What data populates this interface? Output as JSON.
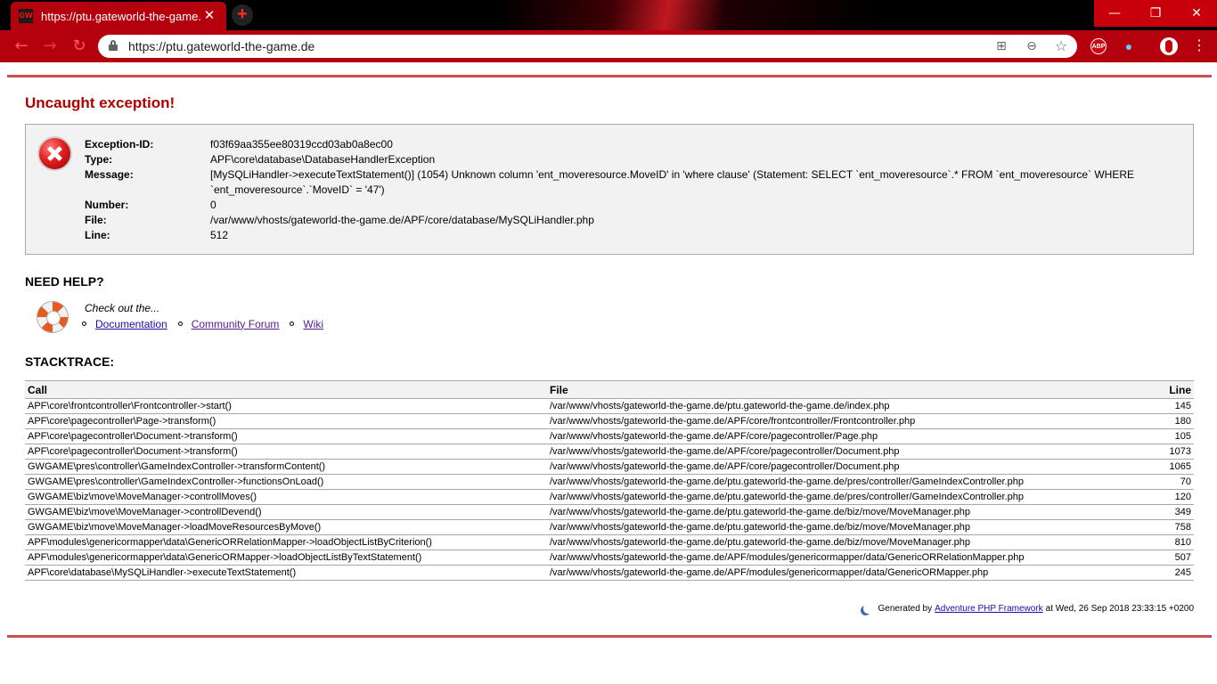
{
  "browser": {
    "tab_title": "https://ptu.gateworld-the-game.de",
    "favicon_text": "GW",
    "tab_close_glyph": "✕",
    "new_tab_glyph": "+",
    "url": "https://ptu.gateworld-the-game.de",
    "window_minimize_glyph": "—",
    "window_maximize_glyph": "❐",
    "window_close_glyph": "✕",
    "back_glyph": "←",
    "forward_glyph": "→",
    "reload_glyph": "↻",
    "translate_glyph": "⊞",
    "zoom_glyph": "⊖",
    "star_glyph": "☆",
    "abp_label": "ABP",
    "ghost_glyph": "●",
    "menu_glyph": "⋮",
    "accent_color": "#b5000e"
  },
  "error": {
    "title": "Uncaught exception!",
    "fields": [
      {
        "label": "Exception-ID:",
        "value": "f03f69aa355ee80319ccd03ab0a8ec00"
      },
      {
        "label": "Type:",
        "value": "APF\\core\\database\\DatabaseHandlerException"
      },
      {
        "label": "Message:",
        "value": "[MySQLiHandler->executeTextStatement()] (1054) Unknown column 'ent_moveresource.MoveID' in 'where clause' (Statement: SELECT `ent_moveresource`.* FROM `ent_moveresource` WHERE `ent_moveresource`.`MoveID` = '47')"
      },
      {
        "label": "Number:",
        "value": "0"
      },
      {
        "label": "File:",
        "value": "/var/www/vhosts/gateworld-the-game.de/APF/core/database/MySQLiHandler.php"
      },
      {
        "label": "Line:",
        "value": "512"
      }
    ]
  },
  "help": {
    "title": "NEED HELP?",
    "checkout": "Check out the...",
    "links": [
      "Documentation",
      "Community Forum",
      "Wiki"
    ]
  },
  "stacktrace": {
    "title": "STACKTRACE:",
    "headers": {
      "call": "Call",
      "file": "File",
      "line": "Line"
    },
    "rows": [
      {
        "call": "APF\\core\\frontcontroller\\Frontcontroller->start()",
        "file": "/var/www/vhosts/gateworld-the-game.de/ptu.gateworld-the-game.de/index.php",
        "line": "145"
      },
      {
        "call": "APF\\core\\pagecontroller\\Page->transform()",
        "file": "/var/www/vhosts/gateworld-the-game.de/APF/core/frontcontroller/Frontcontroller.php",
        "line": "180"
      },
      {
        "call": "APF\\core\\pagecontroller\\Document->transform()",
        "file": "/var/www/vhosts/gateworld-the-game.de/APF/core/pagecontroller/Page.php",
        "line": "105"
      },
      {
        "call": "APF\\core\\pagecontroller\\Document->transform()",
        "file": "/var/www/vhosts/gateworld-the-game.de/APF/core/pagecontroller/Document.php",
        "line": "1073"
      },
      {
        "call": "GWGAME\\pres\\controller\\GameIndexController->transformContent()",
        "file": "/var/www/vhosts/gateworld-the-game.de/APF/core/pagecontroller/Document.php",
        "line": "1065"
      },
      {
        "call": "GWGAME\\pres\\controller\\GameIndexController->functionsOnLoad()",
        "file": "/var/www/vhosts/gateworld-the-game.de/ptu.gateworld-the-game.de/pres/controller/GameIndexController.php",
        "line": "70"
      },
      {
        "call": "GWGAME\\biz\\move\\MoveManager->controllMoves()",
        "file": "/var/www/vhosts/gateworld-the-game.de/ptu.gateworld-the-game.de/pres/controller/GameIndexController.php",
        "line": "120"
      },
      {
        "call": "GWGAME\\biz\\move\\MoveManager->controllDevend()",
        "file": "/var/www/vhosts/gateworld-the-game.de/ptu.gateworld-the-game.de/biz/move/MoveManager.php",
        "line": "349"
      },
      {
        "call": "GWGAME\\biz\\move\\MoveManager->loadMoveResourcesByMove()",
        "file": "/var/www/vhosts/gateworld-the-game.de/ptu.gateworld-the-game.de/biz/move/MoveManager.php",
        "line": "758"
      },
      {
        "call": "APF\\modules\\genericormapper\\data\\GenericORRelationMapper->loadObjectListByCriterion()",
        "file": "/var/www/vhosts/gateworld-the-game.de/ptu.gateworld-the-game.de/biz/move/MoveManager.php",
        "line": "810"
      },
      {
        "call": "APF\\modules\\genericormapper\\data\\GenericORMapper->loadObjectListByTextStatement()",
        "file": "/var/www/vhosts/gateworld-the-game.de/APF/modules/genericormapper/data/GenericORRelationMapper.php",
        "line": "507"
      },
      {
        "call": "APF\\core\\database\\MySQLiHandler->executeTextStatement()",
        "file": "/var/www/vhosts/gateworld-the-game.de/APF/modules/genericormapper/data/GenericORMapper.php",
        "line": "245"
      }
    ]
  },
  "footer": {
    "prefix": "Generated by",
    "link": "Adventure PHP Framework",
    "suffix": "at Wed, 26 Sep 2018 23:33:15 +0200"
  }
}
